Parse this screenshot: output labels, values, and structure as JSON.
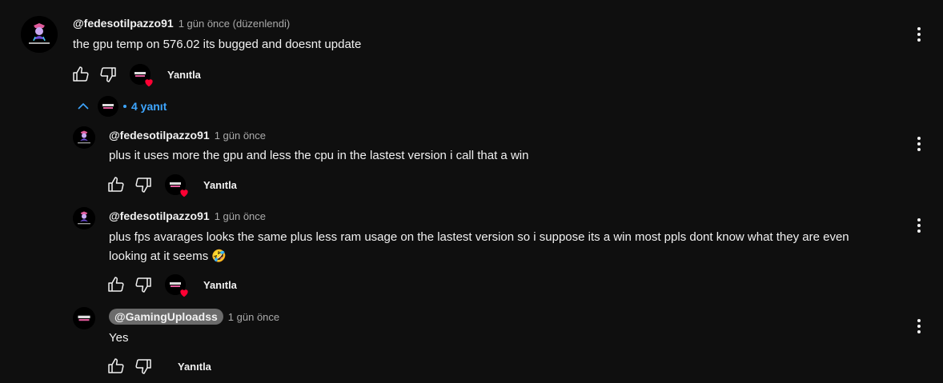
{
  "colors": {
    "background": "#0f0f0f",
    "text": "#f1f1f1",
    "muted": "#aaaaaa",
    "link": "#3ea6ff",
    "heart": "#ff0033"
  },
  "icons": [
    "like-icon",
    "dislike-icon",
    "more-vert-icon",
    "chevron-up-icon",
    "heart-icon"
  ],
  "top_comment": {
    "author": "@fedesotilpazzo91",
    "time": "1 gün önce (düzenlendi)",
    "text": "the gpu temp on 576.02 its bugged and doesnt update",
    "reply_label": "Yanıtla"
  },
  "replies_toggle": {
    "count_label": "4 yanıt"
  },
  "replies": [
    {
      "author": "@fedesotilpazzo91",
      "time": "1 gün önce",
      "text": "plus it uses more the gpu and less the cpu in the lastest version i call that a win",
      "reply_label": "Yanıtla"
    },
    {
      "author": "@fedesotilpazzo91",
      "time": "1 gün önce",
      "text_line1": "plus fps avarages looks the same plus less ram usage on the lastest version  so i suppose its a win most ppls dont know what they are even",
      "text_line2": "looking at it seems 🤣",
      "reply_label": "Yanıtla"
    },
    {
      "author": "@GamingUploadss",
      "time": "1 gün önce",
      "text": "Yes",
      "reply_label": "Yanıtla"
    }
  ]
}
